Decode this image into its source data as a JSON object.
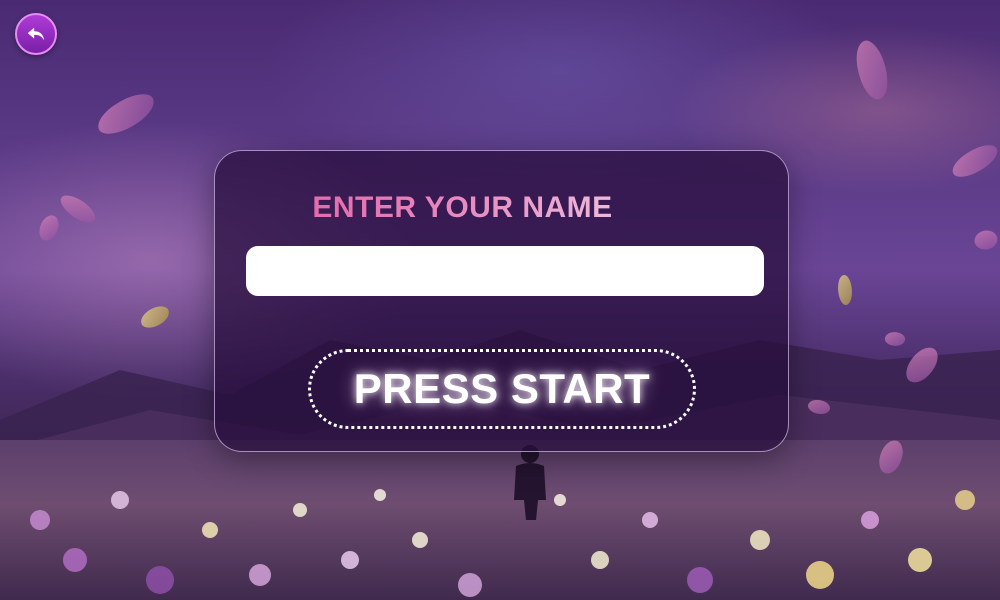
{
  "game": {
    "title": "ENTER YOUR NAME",
    "name_input": {
      "value": "",
      "placeholder": ""
    },
    "start_button_label": "PRESS START"
  },
  "icons": {
    "back": "back-arrow-icon"
  },
  "colors": {
    "title_gradient_start": "#e0509a",
    "title_gradient_end": "#f3e4f2",
    "back_button": "#9a2cc4",
    "panel_background": "#260c3a",
    "start_button_text": "#ffffff"
  }
}
